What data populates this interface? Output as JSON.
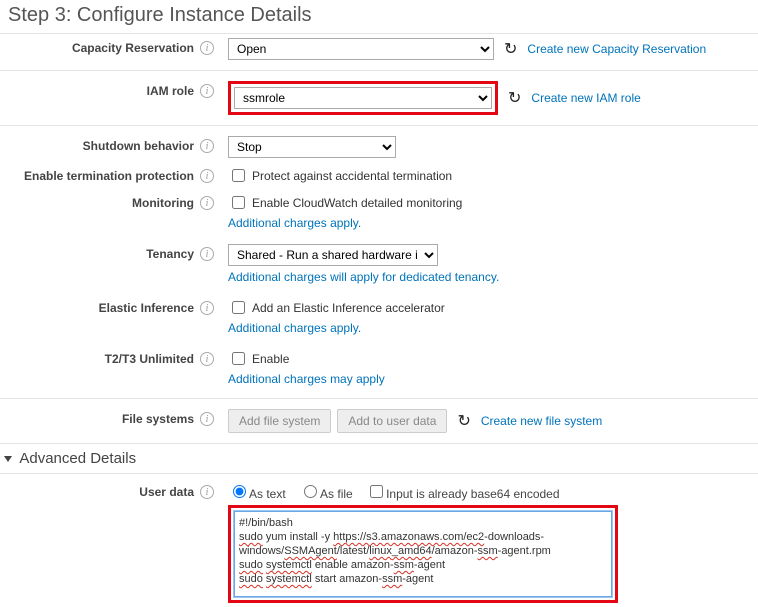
{
  "title": "Step 3: Configure Instance Details",
  "rows": {
    "capacity": {
      "label": "Capacity Reservation",
      "value": "Open",
      "link": "Create new Capacity Reservation"
    },
    "iam": {
      "label": "IAM role",
      "value": "ssmrole",
      "link": "Create new IAM role"
    },
    "shutdown": {
      "label": "Shutdown behavior",
      "value": "Stop"
    },
    "termination": {
      "label": "Enable termination protection",
      "checkbox": "Protect against accidental termination"
    },
    "monitoring": {
      "label": "Monitoring",
      "checkbox": "Enable CloudWatch detailed monitoring",
      "sublink": "Additional charges apply."
    },
    "tenancy": {
      "label": "Tenancy",
      "value": "Shared - Run a shared hardware instance",
      "sublink": "Additional charges will apply for dedicated tenancy."
    },
    "elastic": {
      "label": "Elastic Inference",
      "checkbox": "Add an Elastic Inference accelerator",
      "sublink": "Additional charges apply."
    },
    "unlimited": {
      "label": "T2/T3 Unlimited",
      "checkbox": "Enable",
      "sublink": "Additional charges may apply"
    },
    "filesys": {
      "label": "File systems",
      "btn1": "Add file system",
      "btn2": "Add to user data",
      "link": "Create new file system"
    }
  },
  "adv": {
    "header": "Advanced Details",
    "userdata": {
      "label": "User data",
      "radio_text": "As text",
      "radio_file": "As file",
      "check_base64": "Input is already base64 encoded",
      "script": {
        "l1": "#!/bin/bash",
        "l2a": "sudo",
        "l2b": " yum install -y ",
        "l2c": "https://s3.amazonaws.com/ec2",
        "l2d": "-downloads-windows/",
        "l2e": "SSMAgent",
        "l2f": "/latest/",
        "l2g": "linux_amd64",
        "l2h": "/amazon-",
        "l2i": "ssm",
        "l2j": "-agent.rpm",
        "l3a": "sudo",
        "l3b": " ",
        "l3c": "systemctl",
        "l3d": " enable amazon-",
        "l3e": "ssm",
        "l3f": "-agent",
        "l4a": "sudo",
        "l4b": " ",
        "l4c": "systemctl",
        "l4d": " start amazon-",
        "l4e": "ssm",
        "l4f": "-agent"
      }
    }
  }
}
